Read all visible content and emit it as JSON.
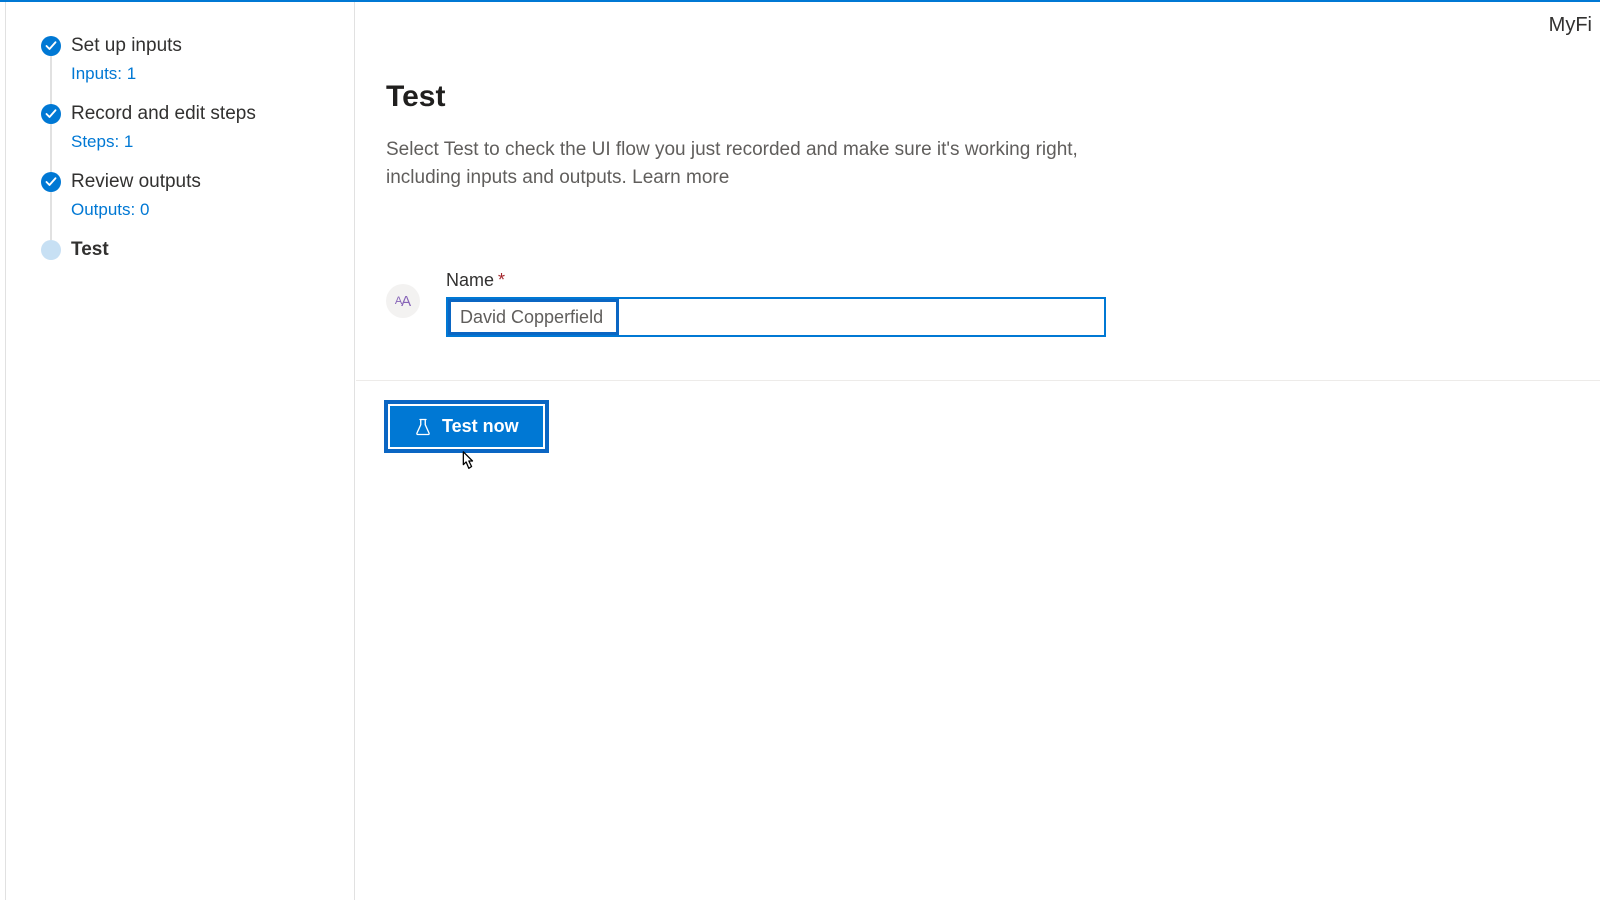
{
  "header": {
    "right_text": "MyFi"
  },
  "sidebar": {
    "steps": [
      {
        "title": "Set up inputs",
        "sub": "Inputs: 1",
        "state": "done"
      },
      {
        "title": "Record and edit steps",
        "sub": "Steps: 1",
        "state": "done"
      },
      {
        "title": "Review outputs",
        "sub": "Outputs: 0",
        "state": "done"
      },
      {
        "title": "Test",
        "sub": "",
        "state": "current"
      }
    ]
  },
  "main": {
    "title": "Test",
    "description_a": "Select Test to check the UI flow you just recorded and make sure it's working right, including inputs and outputs. ",
    "learn_more": "Learn more",
    "field": {
      "type_badge_small": "A",
      "type_badge_big": "A",
      "label": "Name",
      "required_mark": "*",
      "value": "David Copperfield"
    },
    "action": {
      "test_now": "Test now"
    }
  },
  "colors": {
    "accent": "#0078d4",
    "highlight": "#0b66c3"
  }
}
